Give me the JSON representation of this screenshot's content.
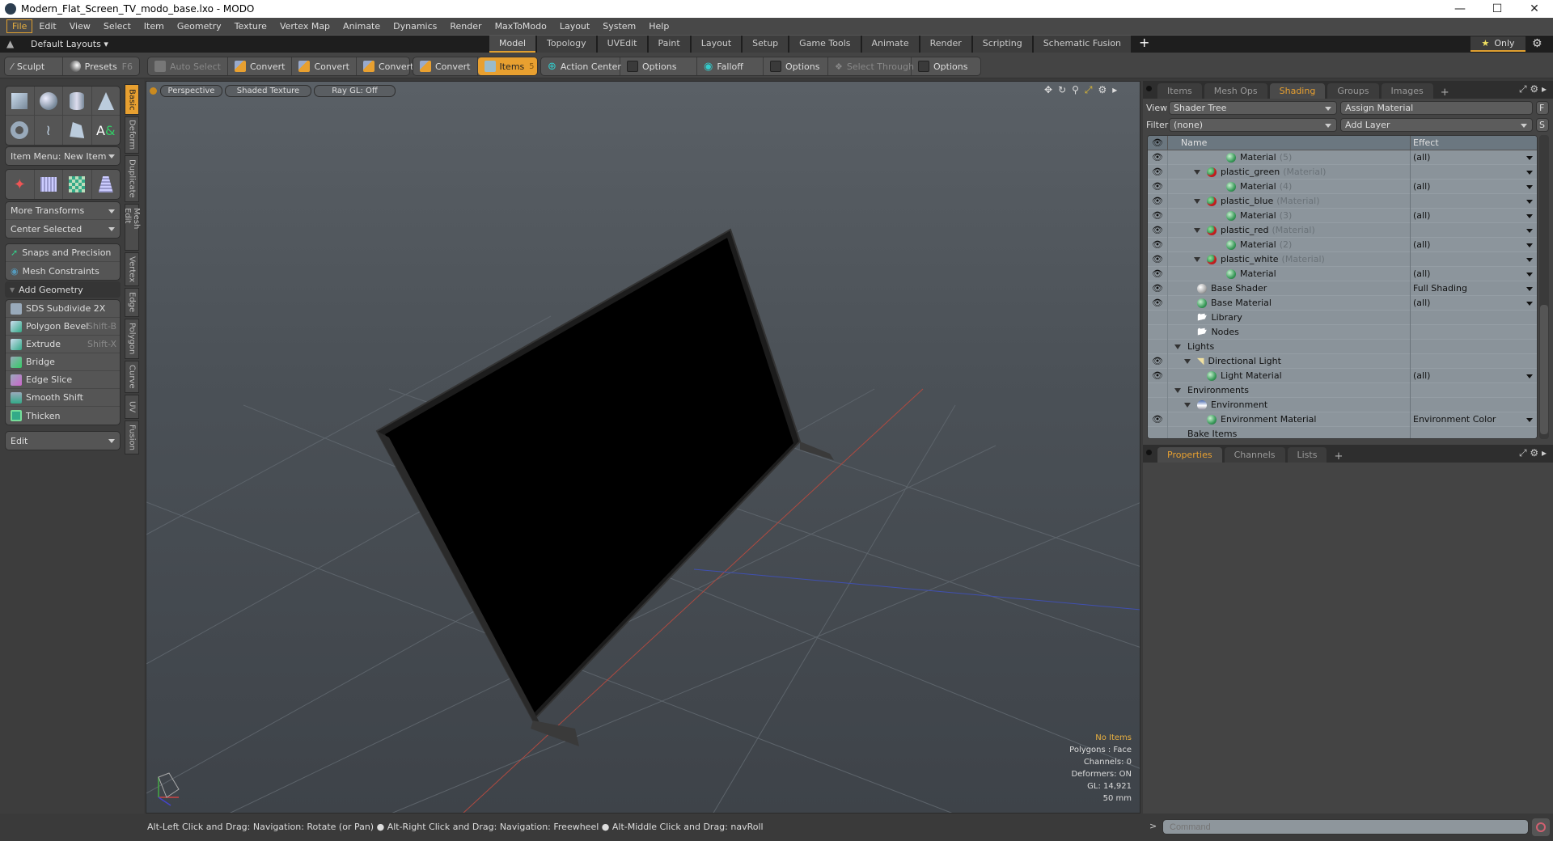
{
  "window": {
    "title": "Modern_Flat_Screen_TV_modo_base.lxo - MODO",
    "controls": [
      "minimize",
      "maximize",
      "close"
    ]
  },
  "menubar": [
    "File",
    "Edit",
    "View",
    "Select",
    "Item",
    "Geometry",
    "Texture",
    "Vertex Map",
    "Animate",
    "Dynamics",
    "Render",
    "MaxToModo",
    "Layout",
    "System",
    "Help"
  ],
  "layoutbar": {
    "layouts_label": "Default Layouts",
    "tabs": [
      "Model",
      "Topology",
      "UVEdit",
      "Paint",
      "Layout",
      "Setup",
      "Game Tools",
      "Animate",
      "Render",
      "Scripting",
      "Schematic Fusion"
    ],
    "active_tab": "Model",
    "add_label": "+",
    "only_label": "Only"
  },
  "toolbar": {
    "sculpt": "Sculpt",
    "presets": "Presets",
    "presets_shortcut": "F6",
    "auto_select": "Auto Select",
    "convert1": "Convert",
    "convert2": "Convert",
    "convert3": "Convert",
    "convert4": "Convert",
    "items": "Items",
    "items_count": "5",
    "action_center": "Action Center",
    "options1": "Options",
    "falloff": "Falloff",
    "options2": "Options",
    "select_through": "Select Through",
    "options3": "Options"
  },
  "leftpanel": {
    "item_menu": "Item Menu: New Item",
    "more_transforms": "More Transforms",
    "center_selected": "Center Selected",
    "snaps": "Snaps and Precision",
    "mesh_constraints": "Mesh Constraints",
    "add_geometry": "Add Geometry",
    "tools": [
      {
        "label": "SDS Subdivide 2X",
        "shortcut": ""
      },
      {
        "label": "Polygon Bevel",
        "shortcut": "Shift-B"
      },
      {
        "label": "Extrude",
        "shortcut": "Shift-X"
      },
      {
        "label": "Bridge",
        "shortcut": ""
      },
      {
        "label": "Edge Slice",
        "shortcut": ""
      },
      {
        "label": "Smooth Shift",
        "shortcut": ""
      },
      {
        "label": "Thicken",
        "shortcut": ""
      }
    ],
    "edit": "Edit",
    "vtabs": [
      "Basic",
      "Deform",
      "Duplicate",
      "Mesh Edit",
      "Vertex",
      "Edge",
      "Polygon",
      "Curve",
      "UV",
      "Fusion"
    ]
  },
  "viewport": {
    "view": "Perspective",
    "shading": "Shaded Texture",
    "raygl": "Ray GL: Off",
    "info": {
      "items": "No Items",
      "polygons": "Polygons : Face",
      "channels": "Channels: 0",
      "deformers": "Deformers: ON",
      "gl": "GL: 14,921",
      "focal": "50 mm"
    }
  },
  "status": "Alt-Left Click and Drag: Navigation: Rotate (or Pan) ● Alt-Right Click and Drag: Navigation: Freewheel ● Alt-Middle Click and Drag: navRoll",
  "rightpanel": {
    "tabs": [
      "Items",
      "Mesh Ops",
      "Shading",
      "Groups",
      "Images"
    ],
    "active_tab": "Shading",
    "view_label": "View",
    "view_value": "Shader Tree",
    "assign_material": "Assign Material",
    "f_button": "F",
    "filter_label": "Filter",
    "filter_value": "(none)",
    "add_layer": "Add Layer",
    "s_button": "S",
    "col_name": "Name",
    "col_effect": "Effect",
    "rows": [
      {
        "eye": true,
        "indent": 4,
        "icon": "green",
        "name": "Material",
        "sub": "(5)",
        "effect": "(all)",
        "dd": true
      },
      {
        "eye": true,
        "indent": 2,
        "icon": "red",
        "name": "plastic_green",
        "sub": "(Material)",
        "effect": "",
        "dd": true,
        "tri": true
      },
      {
        "eye": true,
        "indent": 4,
        "icon": "green",
        "name": "Material",
        "sub": "(4)",
        "effect": "(all)",
        "dd": true
      },
      {
        "eye": true,
        "indent": 2,
        "icon": "red",
        "name": "plastic_blue",
        "sub": "(Material)",
        "effect": "",
        "dd": true,
        "tri": true
      },
      {
        "eye": true,
        "indent": 4,
        "icon": "green",
        "name": "Material",
        "sub": "(3)",
        "effect": "(all)",
        "dd": true
      },
      {
        "eye": true,
        "indent": 2,
        "icon": "red",
        "name": "plastic_red",
        "sub": "(Material)",
        "effect": "",
        "dd": true,
        "tri": true
      },
      {
        "eye": true,
        "indent": 4,
        "icon": "green",
        "name": "Material",
        "sub": "(2)",
        "effect": "(all)",
        "dd": true
      },
      {
        "eye": true,
        "indent": 2,
        "icon": "red",
        "name": "plastic_white",
        "sub": "(Material)",
        "effect": "",
        "dd": true,
        "tri": true
      },
      {
        "eye": true,
        "indent": 4,
        "icon": "green",
        "name": "Material",
        "sub": "",
        "effect": "(all)",
        "dd": true
      },
      {
        "eye": true,
        "indent": 1,
        "icon": "grey",
        "name": "Base Shader",
        "sub": "",
        "effect": "Full Shading",
        "dd": true
      },
      {
        "eye": true,
        "indent": 1,
        "icon": "green",
        "name": "Base Material",
        "sub": "",
        "effect": "(all)",
        "dd": true
      },
      {
        "eye": false,
        "indent": 1,
        "icon": "folder",
        "name": "Library",
        "sub": "",
        "effect": "",
        "dd": false
      },
      {
        "eye": false,
        "indent": 1,
        "icon": "folder",
        "name": "Nodes",
        "sub": "",
        "effect": "",
        "dd": false
      },
      {
        "eye": false,
        "indent": 0,
        "icon": "",
        "name": "Lights",
        "sub": "",
        "effect": "",
        "dd": false,
        "tri": true
      },
      {
        "eye": true,
        "indent": 1,
        "icon": "light",
        "name": "Directional Light",
        "sub": "",
        "effect": "",
        "dd": false,
        "tri": true
      },
      {
        "eye": true,
        "indent": 2,
        "icon": "green",
        "name": "Light Material",
        "sub": "",
        "effect": "(all)",
        "dd": true
      },
      {
        "eye": false,
        "indent": 0,
        "icon": "",
        "name": "Environments",
        "sub": "",
        "effect": "",
        "dd": false,
        "tri": true
      },
      {
        "eye": false,
        "indent": 1,
        "icon": "env",
        "name": "Environment",
        "sub": "",
        "effect": "",
        "dd": false,
        "tri": true
      },
      {
        "eye": true,
        "indent": 2,
        "icon": "green",
        "name": "Environment Material",
        "sub": "",
        "effect": "Environment Color",
        "dd": true
      },
      {
        "eye": false,
        "indent": 0,
        "icon": "",
        "name": "Bake Items",
        "sub": "",
        "effect": "",
        "dd": false
      }
    ],
    "bottom_tabs": [
      "Properties",
      "Channels",
      "Lists"
    ],
    "bottom_active": "Properties",
    "command_placeholder": "Command"
  },
  "colors": {
    "accent": "#e8a030",
    "panel": "#444444",
    "tree_bg": "#8c959c"
  }
}
